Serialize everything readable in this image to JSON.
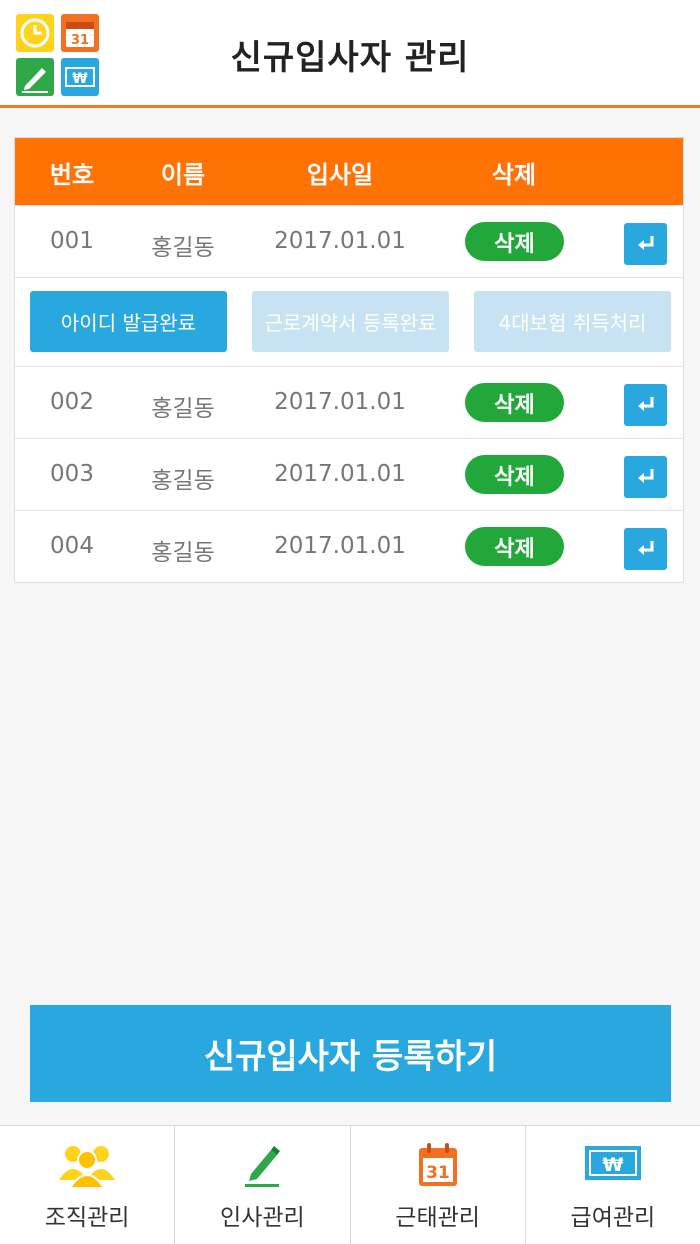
{
  "header": {
    "title": "신규입사자 관리"
  },
  "table": {
    "columns": [
      "번호",
      "이름",
      "입사일",
      "삭제"
    ],
    "rows": [
      {
        "no": "001",
        "name": "홍길동",
        "date": "2017.01.01",
        "delete_label": "삭제"
      },
      {
        "no": "002",
        "name": "홍길동",
        "date": "2017.01.01",
        "delete_label": "삭제"
      },
      {
        "no": "003",
        "name": "홍길동",
        "date": "2017.01.01",
        "delete_label": "삭제"
      },
      {
        "no": "004",
        "name": "홍길동",
        "date": "2017.01.01",
        "delete_label": "삭제"
      }
    ],
    "actions": [
      "아이디 발급완료",
      "근로계약서 등록완료",
      "4대보험 취득처리"
    ]
  },
  "register_button": "신규입사자 등록하기",
  "bottom_nav": [
    {
      "label": "조직관리",
      "icon": "people-icon"
    },
    {
      "label": "인사관리",
      "icon": "pen-icon"
    },
    {
      "label": "근태관리",
      "icon": "calendar-icon"
    },
    {
      "label": "급여관리",
      "icon": "won-bill-icon"
    }
  ],
  "calendar_day": "31",
  "won_symbol": "₩",
  "colors": {
    "accent_orange": "#ff7203",
    "blue": "#29a8df",
    "green": "#22a83a",
    "light_blue": "#c7e3f3"
  }
}
